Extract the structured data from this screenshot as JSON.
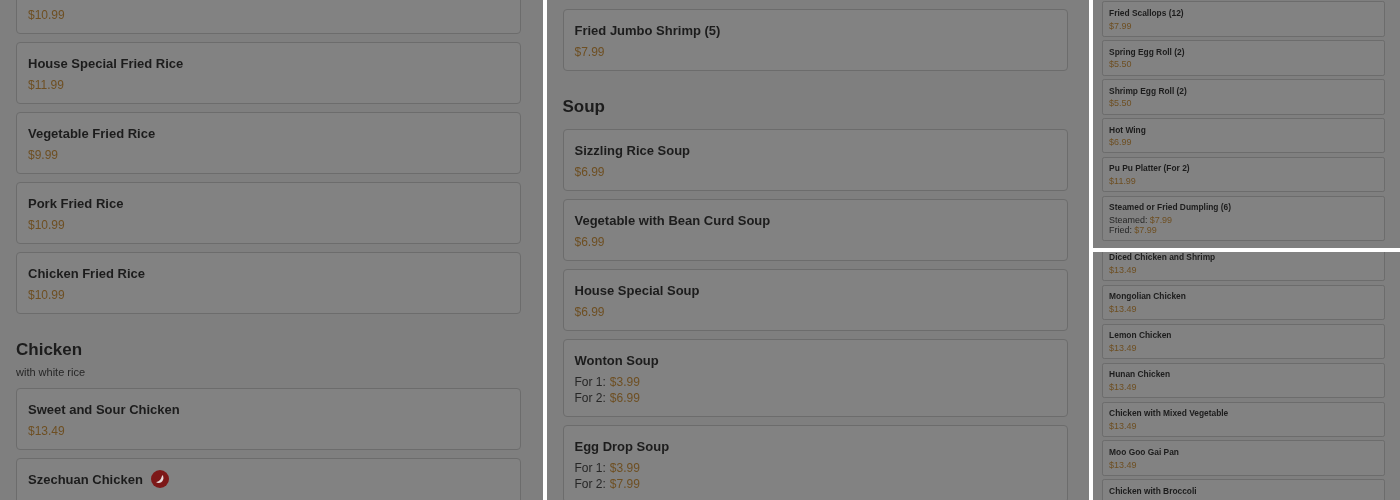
{
  "panels": [
    {
      "blocks": [
        {
          "kind": "item",
          "prices": [
            {
              "price": "$10.99"
            }
          ]
        },
        {
          "kind": "item",
          "name": "House Special Fried Rice",
          "prices": [
            {
              "price": "$11.99"
            }
          ]
        },
        {
          "kind": "item",
          "name": "Vegetable Fried Rice",
          "prices": [
            {
              "price": "$9.99"
            }
          ]
        },
        {
          "kind": "item",
          "name": "Pork Fried Rice",
          "prices": [
            {
              "price": "$10.99"
            }
          ]
        },
        {
          "kind": "item",
          "name": "Chicken Fried Rice",
          "prices": [
            {
              "price": "$10.99"
            }
          ]
        },
        {
          "kind": "heading",
          "title": "Chicken",
          "subtitle": "with white rice"
        },
        {
          "kind": "item",
          "name": "Sweet and Sour Chicken",
          "prices": [
            {
              "price": "$13.49"
            }
          ]
        },
        {
          "kind": "item",
          "name": "Szechuan Chicken",
          "spicy": true
        }
      ]
    },
    {
      "blocks": [
        {
          "kind": "item",
          "name": "Fried Jumbo Shrimp (5)",
          "prices": [
            {
              "price": "$7.99"
            }
          ]
        },
        {
          "kind": "heading",
          "title": "Soup"
        },
        {
          "kind": "item",
          "name": "Sizzling Rice Soup",
          "prices": [
            {
              "price": "$6.99"
            }
          ]
        },
        {
          "kind": "item",
          "name": "Vegetable with Bean Curd Soup",
          "prices": [
            {
              "price": "$6.99"
            }
          ]
        },
        {
          "kind": "item",
          "name": "House Special Soup",
          "prices": [
            {
              "price": "$6.99"
            }
          ]
        },
        {
          "kind": "item",
          "name": "Wonton Soup",
          "prices": [
            {
              "label": "For 1:",
              "price": "$3.99"
            },
            {
              "label": "For 2:",
              "price": "$6.99"
            }
          ]
        },
        {
          "kind": "item",
          "name": "Egg Drop Soup",
          "prices": [
            {
              "label": "For 1:",
              "price": "$3.99"
            },
            {
              "label": "For 2:",
              "price": "$7.99"
            }
          ]
        }
      ]
    },
    {
      "blocks": [
        {
          "kind": "item",
          "name": "Fried Scallops (12)",
          "prices": [
            {
              "price": "$7.99"
            }
          ]
        },
        {
          "kind": "item",
          "name": "Spring Egg Roll (2)",
          "prices": [
            {
              "price": "$5.50"
            }
          ]
        },
        {
          "kind": "item",
          "name": "Shrimp Egg Roll (2)",
          "prices": [
            {
              "price": "$5.50"
            }
          ]
        },
        {
          "kind": "item",
          "name": "Hot Wing",
          "prices": [
            {
              "price": "$6.99"
            }
          ]
        },
        {
          "kind": "item",
          "name": "Pu Pu Platter (For 2)",
          "prices": [
            {
              "price": "$11.99"
            }
          ]
        },
        {
          "kind": "item",
          "name": "Steamed or Fried Dumpling (6)",
          "prices": [
            {
              "label": "Steamed:",
              "price": "$7.99"
            },
            {
              "label": "Fried:",
              "price": "$7.99"
            }
          ]
        }
      ]
    },
    {
      "blocks": [
        {
          "kind": "item",
          "name": "Diced Chicken and Shrimp",
          "prices": [
            {
              "price": "$13.49"
            }
          ]
        },
        {
          "kind": "item",
          "name": "Mongolian Chicken",
          "prices": [
            {
              "price": "$13.49"
            }
          ]
        },
        {
          "kind": "item",
          "name": "Lemon Chicken",
          "prices": [
            {
              "price": "$13.49"
            }
          ]
        },
        {
          "kind": "item",
          "name": "Hunan Chicken",
          "prices": [
            {
              "price": "$13.49"
            }
          ]
        },
        {
          "kind": "item",
          "name": "Chicken with Mixed Vegetable",
          "prices": [
            {
              "price": "$13.49"
            }
          ]
        },
        {
          "kind": "item",
          "name": "Moo Goo Gai Pan",
          "prices": [
            {
              "price": "$13.49"
            }
          ]
        },
        {
          "kind": "item",
          "name": "Chicken with Broccoli"
        }
      ]
    }
  ]
}
